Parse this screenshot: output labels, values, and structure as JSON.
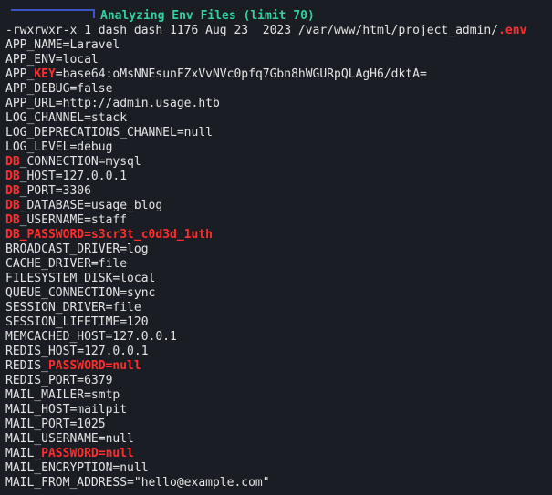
{
  "header": {
    "title": "Analyzing Env Files (limit 70)"
  },
  "file_listing": {
    "prefix": "-rwxrwxr-x 1 dash dash 1176 Aug 23  2023 /var/www/html/project_admin/",
    "highlight": ".env"
  },
  "env_lines": [
    {
      "pre": "APP_NAME=Laravel",
      "hl": "",
      "post": ""
    },
    {
      "pre": "APP_ENV=local",
      "hl": "",
      "post": ""
    },
    {
      "pre": "APP_",
      "hl": "KEY",
      "post": "=base64:oMsNNEsunFZxVvNVc0pfq7Gbn8hWGURpQLAgH6/dktA="
    },
    {
      "pre": "APP_DEBUG=false",
      "hl": "",
      "post": ""
    },
    {
      "pre": "APP_URL=http://admin.usage.htb",
      "hl": "",
      "post": ""
    },
    {
      "pre": "LOG_CHANNEL=stack",
      "hl": "",
      "post": ""
    },
    {
      "pre": "LOG_DEPRECATIONS_CHANNEL=null",
      "hl": "",
      "post": ""
    },
    {
      "pre": "LOG_LEVEL=debug",
      "hl": "",
      "post": ""
    },
    {
      "pre": "",
      "hl": "DB",
      "post": "_CONNECTION=mysql"
    },
    {
      "pre": "",
      "hl": "DB",
      "post": "_HOST=127.0.0.1"
    },
    {
      "pre": "",
      "hl": "DB",
      "post": "_PORT=3306"
    },
    {
      "pre": "",
      "hl": "DB",
      "post": "_DATABASE=usage_blog"
    },
    {
      "pre": "",
      "hl": "DB",
      "post": "_USERNAME=staff"
    },
    {
      "pre": "",
      "hl": "DB_PASSWORD=s3cr3t_c0d3d_1uth",
      "post": ""
    },
    {
      "pre": "BROADCAST_DRIVER=log",
      "hl": "",
      "post": ""
    },
    {
      "pre": "CACHE_DRIVER=file",
      "hl": "",
      "post": ""
    },
    {
      "pre": "FILESYSTEM_DISK=local",
      "hl": "",
      "post": ""
    },
    {
      "pre": "QUEUE_CONNECTION=sync",
      "hl": "",
      "post": ""
    },
    {
      "pre": "SESSION_DRIVER=file",
      "hl": "",
      "post": ""
    },
    {
      "pre": "SESSION_LIFETIME=120",
      "hl": "",
      "post": ""
    },
    {
      "pre": "MEMCACHED_HOST=127.0.0.1",
      "hl": "",
      "post": ""
    },
    {
      "pre": "REDIS_HOST=127.0.0.1",
      "hl": "",
      "post": ""
    },
    {
      "pre": "REDIS_",
      "hl": "PASSWORD=null",
      "post": ""
    },
    {
      "pre": "REDIS_PORT=6379",
      "hl": "",
      "post": ""
    },
    {
      "pre": "MAIL_MAILER=smtp",
      "hl": "",
      "post": ""
    },
    {
      "pre": "MAIL_HOST=mailpit",
      "hl": "",
      "post": ""
    },
    {
      "pre": "MAIL_PORT=1025",
      "hl": "",
      "post": ""
    },
    {
      "pre": "MAIL_USERNAME=null",
      "hl": "",
      "post": ""
    },
    {
      "pre": "MAIL_",
      "hl": "PASSWORD=null",
      "post": ""
    },
    {
      "pre": "MAIL_ENCRYPTION=null",
      "hl": "",
      "post": ""
    },
    {
      "pre": "MAIL_FROM_ADDRESS=\"hello@example.com\"",
      "hl": "",
      "post": ""
    }
  ],
  "colors": {
    "background": "#1a1d24",
    "text": "#e4e4e4",
    "highlight": "#ff2d2d",
    "header_title": "#35d0a0",
    "header_bracket": "#3b55c7"
  }
}
